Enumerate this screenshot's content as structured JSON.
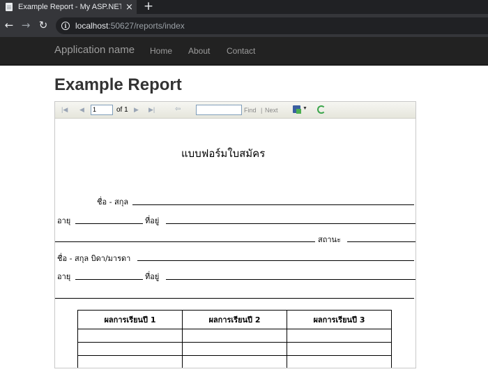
{
  "browser": {
    "tab_title": "Example Report - My ASP.NET Ap",
    "tab_close": "×",
    "new_tab": "+",
    "url_host": "localhost",
    "url_path": ":50627/reports/index"
  },
  "navbar": {
    "brand": "Application name",
    "links": [
      "Home",
      "About",
      "Contact"
    ]
  },
  "page": {
    "title": "Example Report"
  },
  "viewer_toolbar": {
    "page_value": "1",
    "of_label": "of 1",
    "find_label": "Find",
    "separator": "|",
    "next_label": "Next"
  },
  "report": {
    "title": "แบบฟอร์มใบสมัคร",
    "name_label": "ชื่อ - สกุล",
    "age_label": "อายุ",
    "address_label": "ที่อยู่",
    "status_label": "สถานะ",
    "parent_name_label": "ชื่อ - สกุล บิดา/มารดา",
    "age_label_2": "อายุ",
    "address_label_2": "ที่อยู่",
    "table_headers": [
      "ผลการเรียนปี 1",
      "ผลการเรียนปี 2",
      "ผลการเรียนปี 3"
    ]
  }
}
